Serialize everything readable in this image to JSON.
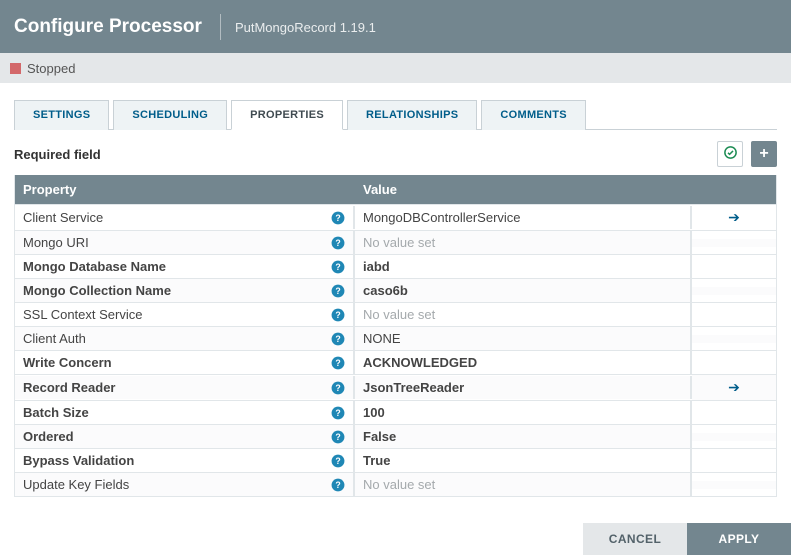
{
  "header": {
    "title": "Configure Processor",
    "subtitle": "PutMongoRecord 1.19.1"
  },
  "status": {
    "label": "Stopped"
  },
  "tabs": {
    "settings": "SETTINGS",
    "scheduling": "SCHEDULING",
    "properties": "PROPERTIES",
    "relationships": "RELATIONSHIPS",
    "comments": "COMMENTS",
    "active_index": 2
  },
  "toolbar": {
    "required_label": "Required field"
  },
  "table": {
    "head_property": "Property",
    "head_value": "Value",
    "no_value_text": "No value set",
    "rows": [
      {
        "name": "Client Service",
        "bold": false,
        "value": "MongoDBControllerService",
        "val_bold": false,
        "arrow": true
      },
      {
        "name": "Mongo URI",
        "bold": false,
        "value": null,
        "val_bold": false,
        "arrow": false
      },
      {
        "name": "Mongo Database Name",
        "bold": true,
        "value": "iabd",
        "val_bold": true,
        "arrow": false
      },
      {
        "name": "Mongo Collection Name",
        "bold": true,
        "value": "caso6b",
        "val_bold": true,
        "arrow": false
      },
      {
        "name": "SSL Context Service",
        "bold": false,
        "value": null,
        "val_bold": false,
        "arrow": false
      },
      {
        "name": "Client Auth",
        "bold": false,
        "value": "NONE",
        "val_bold": false,
        "arrow": false
      },
      {
        "name": "Write Concern",
        "bold": true,
        "value": "ACKNOWLEDGED",
        "val_bold": true,
        "arrow": false
      },
      {
        "name": "Record Reader",
        "bold": true,
        "value": "JsonTreeReader",
        "val_bold": true,
        "arrow": true
      },
      {
        "name": "Batch Size",
        "bold": true,
        "value": "100",
        "val_bold": true,
        "arrow": false
      },
      {
        "name": "Ordered",
        "bold": true,
        "value": "False",
        "val_bold": true,
        "arrow": false
      },
      {
        "name": "Bypass Validation",
        "bold": true,
        "value": "True",
        "val_bold": true,
        "arrow": false
      },
      {
        "name": "Update Key Fields",
        "bold": false,
        "value": null,
        "val_bold": false,
        "arrow": false
      }
    ]
  },
  "footer": {
    "cancel": "CANCEL",
    "apply": "APPLY"
  }
}
